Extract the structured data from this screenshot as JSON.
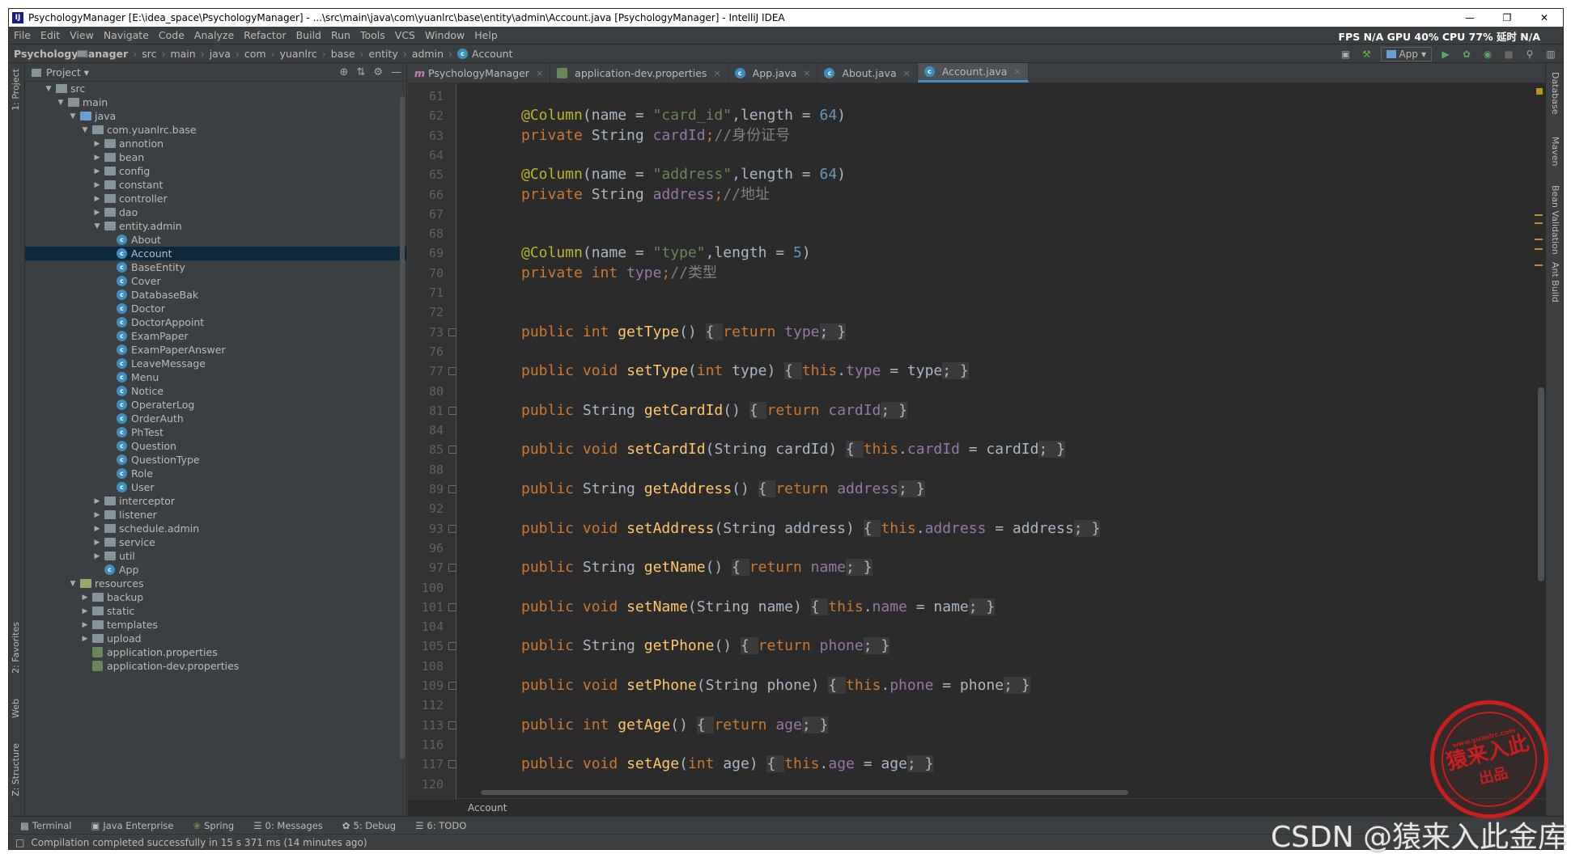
{
  "window": {
    "title": "PsychologyManager [E:\\idea_space\\PsychologyManager] - ...\\src\\main\\java\\com\\yuanlrc\\base\\entity\\admin\\Account.java [PsychologyManager] - IntelliJ IDEA"
  },
  "menu": [
    "File",
    "Edit",
    "View",
    "Navigate",
    "Code",
    "Analyze",
    "Refactor",
    "Build",
    "Run",
    "Tools",
    "VCS",
    "Window",
    "Help"
  ],
  "stats": "FPS N/A GPU 40% CPU 77% 延时 N/A",
  "breadcrumb": [
    "PsychologyManager",
    "src",
    "main",
    "java",
    "com",
    "yuanlrc",
    "base",
    "entity",
    "admin",
    "Account"
  ],
  "run_config": "App",
  "project_panel": {
    "title": "Project"
  },
  "tree": [
    {
      "depth": 1,
      "arrow": "▼",
      "icon": "folder",
      "label": "src"
    },
    {
      "depth": 2,
      "arrow": "▼",
      "icon": "folder",
      "label": "main"
    },
    {
      "depth": 3,
      "arrow": "▼",
      "icon": "folder-blue",
      "label": "java"
    },
    {
      "depth": 4,
      "arrow": "▼",
      "icon": "folder",
      "label": "com.yuanlrc.base"
    },
    {
      "depth": 5,
      "arrow": "▶",
      "icon": "folder",
      "label": "annotion"
    },
    {
      "depth": 5,
      "arrow": "▶",
      "icon": "folder",
      "label": "bean"
    },
    {
      "depth": 5,
      "arrow": "▶",
      "icon": "folder",
      "label": "config"
    },
    {
      "depth": 5,
      "arrow": "▶",
      "icon": "folder",
      "label": "constant"
    },
    {
      "depth": 5,
      "arrow": "▶",
      "icon": "folder",
      "label": "controller"
    },
    {
      "depth": 5,
      "arrow": "▶",
      "icon": "folder",
      "label": "dao"
    },
    {
      "depth": 5,
      "arrow": "▼",
      "icon": "folder",
      "label": "entity.admin"
    },
    {
      "depth": 6,
      "arrow": "",
      "icon": "class",
      "label": "About"
    },
    {
      "depth": 6,
      "arrow": "",
      "icon": "class",
      "label": "Account",
      "selected": true
    },
    {
      "depth": 6,
      "arrow": "",
      "icon": "class",
      "label": "BaseEntity"
    },
    {
      "depth": 6,
      "arrow": "",
      "icon": "class",
      "label": "Cover"
    },
    {
      "depth": 6,
      "arrow": "",
      "icon": "class",
      "label": "DatabaseBak"
    },
    {
      "depth": 6,
      "arrow": "",
      "icon": "class",
      "label": "Doctor"
    },
    {
      "depth": 6,
      "arrow": "",
      "icon": "class",
      "label": "DoctorAppoint"
    },
    {
      "depth": 6,
      "arrow": "",
      "icon": "class",
      "label": "ExamPaper"
    },
    {
      "depth": 6,
      "arrow": "",
      "icon": "class",
      "label": "ExamPaperAnswer"
    },
    {
      "depth": 6,
      "arrow": "",
      "icon": "class",
      "label": "LeaveMessage"
    },
    {
      "depth": 6,
      "arrow": "",
      "icon": "class",
      "label": "Menu"
    },
    {
      "depth": 6,
      "arrow": "",
      "icon": "class",
      "label": "Notice"
    },
    {
      "depth": 6,
      "arrow": "",
      "icon": "class",
      "label": "OperaterLog"
    },
    {
      "depth": 6,
      "arrow": "",
      "icon": "class",
      "label": "OrderAuth"
    },
    {
      "depth": 6,
      "arrow": "",
      "icon": "class",
      "label": "PhTest"
    },
    {
      "depth": 6,
      "arrow": "",
      "icon": "class",
      "label": "Question"
    },
    {
      "depth": 6,
      "arrow": "",
      "icon": "class",
      "label": "QuestionType"
    },
    {
      "depth": 6,
      "arrow": "",
      "icon": "class",
      "label": "Role"
    },
    {
      "depth": 6,
      "arrow": "",
      "icon": "class",
      "label": "User"
    },
    {
      "depth": 5,
      "arrow": "▶",
      "icon": "folder",
      "label": "interceptor"
    },
    {
      "depth": 5,
      "arrow": "▶",
      "icon": "folder",
      "label": "listener"
    },
    {
      "depth": 5,
      "arrow": "▶",
      "icon": "folder",
      "label": "schedule.admin"
    },
    {
      "depth": 5,
      "arrow": "▶",
      "icon": "folder",
      "label": "service"
    },
    {
      "depth": 5,
      "arrow": "▶",
      "icon": "folder",
      "label": "util"
    },
    {
      "depth": 5,
      "arrow": "",
      "icon": "class",
      "label": "App"
    },
    {
      "depth": 3,
      "arrow": "▼",
      "icon": "folder-res",
      "label": "resources"
    },
    {
      "depth": 4,
      "arrow": "▶",
      "icon": "folder",
      "label": "backup"
    },
    {
      "depth": 4,
      "arrow": "▶",
      "icon": "folder",
      "label": "static"
    },
    {
      "depth": 4,
      "arrow": "▶",
      "icon": "folder",
      "label": "templates"
    },
    {
      "depth": 4,
      "arrow": "▶",
      "icon": "folder",
      "label": "upload"
    },
    {
      "depth": 4,
      "arrow": "",
      "icon": "props",
      "label": "application.properties"
    },
    {
      "depth": 4,
      "arrow": "",
      "icon": "props",
      "label": "application-dev.properties"
    }
  ],
  "tabs": [
    {
      "label": "PsychologyManager",
      "icon": "m-icon"
    },
    {
      "label": "application-dev.properties",
      "icon": "props-icon"
    },
    {
      "label": "App.java",
      "icon": "class-icon"
    },
    {
      "label": "About.java",
      "icon": "class-icon"
    },
    {
      "label": "Account.java",
      "icon": "class-icon",
      "active": true
    }
  ],
  "code_lines": [
    {
      "n": "61",
      "html": ""
    },
    {
      "n": "62",
      "html": "<span class=\"an\">@Column</span>(name = <span class=\"st\">\"card_id\"</span>,length = <span class=\"nm\">64</span>)"
    },
    {
      "n": "63",
      "html": "<span class=\"kw\">private</span> String <span class=\"fd\">cardId</span><span class=\"kw\">;</span><span class=\"cm\">//身份证号</span>"
    },
    {
      "n": "64",
      "html": ""
    },
    {
      "n": "65",
      "html": "<span class=\"an\">@Column</span>(name = <span class=\"st\">\"address\"</span>,length = <span class=\"nm\">64</span>)"
    },
    {
      "n": "66",
      "html": "<span class=\"kw\">private</span> String <span class=\"fd\">address</span><span class=\"kw\">;</span><span class=\"cm\">//地址</span>"
    },
    {
      "n": "67",
      "html": ""
    },
    {
      "n": "68",
      "html": ""
    },
    {
      "n": "69",
      "html": "<span class=\"an\">@Column</span>(name = <span class=\"st\">\"type\"</span>,length = <span class=\"nm\">5</span>)"
    },
    {
      "n": "70",
      "html": "<span class=\"kw\">private int</span> <span class=\"fd\">type</span><span class=\"kw\">;</span><span class=\"cm\">//类型</span>"
    },
    {
      "n": "71",
      "html": ""
    },
    {
      "n": "72",
      "html": ""
    },
    {
      "n": "73",
      "html": "<span class=\"kw\">public int</span> <span class=\"fn\">getType</span>() <span class=\"br\">{ </span><span class=\"kw\">return</span> <span class=\"fd\">type</span><span class=\"br\">; }</span>",
      "fold": true
    },
    {
      "n": "76",
      "html": ""
    },
    {
      "n": "77",
      "html": "<span class=\"kw\">public void</span> <span class=\"fn\">setType</span>(<span class=\"kw\">int</span> type) <span class=\"br\">{ </span><span class=\"kw\">this</span>.<span class=\"fd\">type</span> = type<span class=\"br\">; }</span>",
      "fold": true
    },
    {
      "n": "80",
      "html": ""
    },
    {
      "n": "81",
      "html": "<span class=\"kw\">public</span> String <span class=\"fn\">getCardId</span>() <span class=\"br\">{ </span><span class=\"kw\">return</span> <span class=\"fd\">cardId</span><span class=\"br\">; }</span>",
      "fold": true
    },
    {
      "n": "84",
      "html": ""
    },
    {
      "n": "85",
      "html": "<span class=\"kw\">public void</span> <span class=\"fn\">setCardId</span>(String cardId) <span class=\"br\">{ </span><span class=\"kw\">this</span>.<span class=\"fd\">cardId</span> = cardId<span class=\"br\">; }</span>",
      "fold": true
    },
    {
      "n": "88",
      "html": ""
    },
    {
      "n": "89",
      "html": "<span class=\"kw\">public</span> String <span class=\"fn\">getAddress</span>() <span class=\"br\">{ </span><span class=\"kw\">return</span> <span class=\"fd\">address</span><span class=\"br\">; }</span>",
      "fold": true
    },
    {
      "n": "92",
      "html": ""
    },
    {
      "n": "93",
      "html": "<span class=\"kw\">public void</span> <span class=\"fn\">setAddress</span>(String address) <span class=\"br\">{ </span><span class=\"kw\">this</span>.<span class=\"fd\">address</span> = address<span class=\"br\">; }</span>",
      "fold": true
    },
    {
      "n": "96",
      "html": ""
    },
    {
      "n": "97",
      "html": "<span class=\"kw\">public</span> String <span class=\"fn\">getName</span>() <span class=\"br\">{ </span><span class=\"kw\">return</span> <span class=\"fd\">name</span><span class=\"br\">; }</span>",
      "fold": true
    },
    {
      "n": "100",
      "html": ""
    },
    {
      "n": "101",
      "html": "<span class=\"kw\">public void</span> <span class=\"fn\">setName</span>(String name) <span class=\"br\">{ </span><span class=\"kw\">this</span>.<span class=\"fd\">name</span> = name<span class=\"br\">; }</span>",
      "fold": true
    },
    {
      "n": "104",
      "html": ""
    },
    {
      "n": "105",
      "html": "<span class=\"kw\">public</span> String <span class=\"fn\">getPhone</span>() <span class=\"br\">{ </span><span class=\"kw\">return</span> <span class=\"fd\">phone</span><span class=\"br\">; }</span>",
      "fold": true
    },
    {
      "n": "108",
      "html": ""
    },
    {
      "n": "109",
      "html": "<span class=\"kw\">public void</span> <span class=\"fn\">setPhone</span>(String phone) <span class=\"br\">{ </span><span class=\"kw\">this</span>.<span class=\"fd\">phone</span> = phone<span class=\"br\">; }</span>",
      "fold": true
    },
    {
      "n": "112",
      "html": ""
    },
    {
      "n": "113",
      "html": "<span class=\"kw\">public int</span> <span class=\"fn\">getAge</span>() <span class=\"br\">{ </span><span class=\"kw\">return</span> <span class=\"fd\">age</span><span class=\"br\">; }</span>",
      "fold": true
    },
    {
      "n": "116",
      "html": ""
    },
    {
      "n": "117",
      "html": "<span class=\"kw\">public void</span> <span class=\"fn\">setAge</span>(<span class=\"kw\">int</span> age) <span class=\"br\">{ </span><span class=\"kw\">this</span>.<span class=\"fd\">age</span> = age<span class=\"br\">; }</span>",
      "fold": true
    },
    {
      "n": "120",
      "html": ""
    }
  ],
  "editor_breadcrumb": "Account",
  "left_strip": [
    "1: Project",
    "2: Favorites",
    "Web",
    "Z: Structure"
  ],
  "right_strip": [
    "Database",
    "Maven",
    "Bean Validation",
    "Ant Build"
  ],
  "bottom_tools": [
    "Terminal",
    "Java Enterprise",
    "Spring",
    "0: Messages",
    "5: Debug",
    "6: TODO"
  ],
  "status": "Compilation completed successfully in 15 s 371 ms (14 minutes ago)",
  "watermark": "CSDN @猿来入此金库",
  "stamp": {
    "line1": "www.yuanlrc.com",
    "line2": "猿来入此",
    "line3": "出品"
  }
}
